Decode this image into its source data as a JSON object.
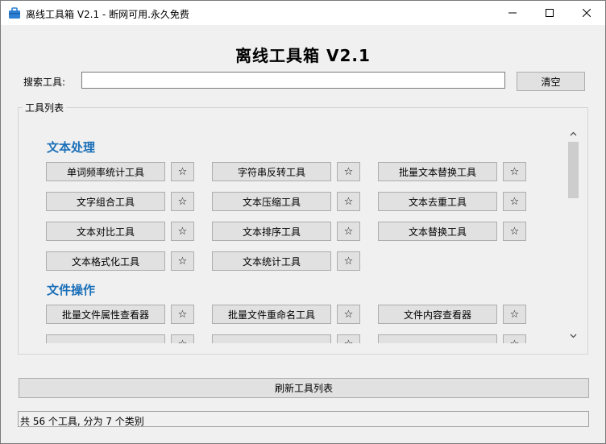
{
  "window": {
    "title": "离线工具箱 V2.1 - 断网可用.永久免费",
    "minimize_icon": "minimize-icon",
    "maximize_icon": "maximize-icon",
    "close_icon": "close-icon"
  },
  "app": {
    "heading": "离线工具箱 V2.1"
  },
  "search": {
    "label": "搜索工具:",
    "value": "",
    "placeholder": "",
    "clear_label": "清空"
  },
  "tool_list": {
    "group_title": "工具列表",
    "favorite_symbol": "☆",
    "categories": [
      {
        "name": "文本处理",
        "tools": [
          "单词频率统计工具",
          "字符串反转工具",
          "批量文本替换工具",
          "文字组合工具",
          "文本压缩工具",
          "文本去重工具",
          "文本对比工具",
          "文本排序工具",
          "文本替换工具",
          "文本格式化工具",
          "文本统计工具"
        ]
      },
      {
        "name": "文件操作",
        "tools": [
          "批量文件属性查看器",
          "批量文件重命名工具",
          "文件内容查看器",
          "",
          "",
          ""
        ]
      }
    ]
  },
  "refresh_label": "刷新工具列表",
  "status": {
    "text": "共 56 个工具, 分为 7 个类别"
  },
  "colors": {
    "accent": "#1a6fb8",
    "button_bg": "#e1e1e1",
    "window_bg": "#f0f0f0"
  }
}
